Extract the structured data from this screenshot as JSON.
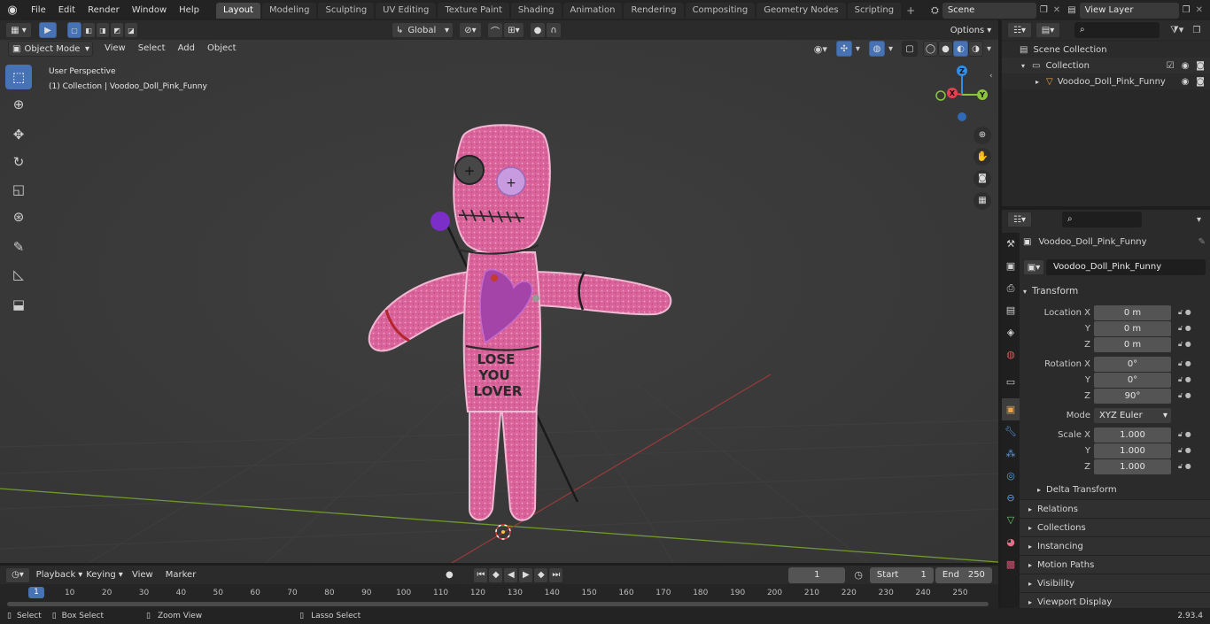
{
  "topbar": {
    "menus": [
      "File",
      "Edit",
      "Render",
      "Window",
      "Help"
    ],
    "workspaces": [
      "Layout",
      "Modeling",
      "Sculpting",
      "UV Editing",
      "Texture Paint",
      "Shading",
      "Animation",
      "Rendering",
      "Compositing",
      "Geometry Nodes",
      "Scripting"
    ],
    "active_workspace": "Layout",
    "scene_name": "Scene",
    "view_layer": "View Layer"
  },
  "header": {
    "transform_orientation": "Global",
    "options_label": "Options"
  },
  "viewport": {
    "mode": "Object Mode",
    "menus": [
      "View",
      "Select",
      "Add",
      "Object"
    ],
    "overlay_title": "User Perspective",
    "overlay_subtitle": "(1) Collection | Voodoo_Doll_Pink_Funny",
    "gizmo_axes": {
      "x": "X",
      "y": "Y",
      "z": "Z"
    },
    "doll_text": [
      "LOSE",
      "YOU",
      "LOVER"
    ]
  },
  "outliner": {
    "scene_collection": "Scene Collection",
    "collection": "Collection",
    "object": "Voodoo_Doll_Pink_Funny"
  },
  "properties": {
    "object_name": "Voodoo_Doll_Pink_Funny",
    "datablock_name": "Voodoo_Doll_Pink_Funny",
    "transform_label": "Transform",
    "location_label": "Location X",
    "rotation_label": "Rotation X",
    "scale_label": "Scale X",
    "y_label": "Y",
    "z_label": "Z",
    "location": [
      "0 m",
      "0 m",
      "0 m"
    ],
    "rotation": [
      "0°",
      "0°",
      "90°"
    ],
    "mode_label": "Mode",
    "mode_value": "XYZ Euler",
    "scale": [
      "1.000",
      "1.000",
      "1.000"
    ],
    "delta_transform": "Delta Transform",
    "sections": [
      "Relations",
      "Collections",
      "Instancing",
      "Motion Paths",
      "Visibility",
      "Viewport Display"
    ]
  },
  "timeline": {
    "menus": [
      "Playback",
      "Keying",
      "View",
      "Marker"
    ],
    "current_frame": "1",
    "start_label": "Start",
    "start_value": "1",
    "end_label": "End",
    "end_value": "250",
    "ticks": [
      "1",
      "10",
      "20",
      "30",
      "40",
      "50",
      "60",
      "70",
      "80",
      "90",
      "100",
      "110",
      "120",
      "130",
      "140",
      "150",
      "160",
      "170",
      "180",
      "190",
      "200",
      "210",
      "220",
      "230",
      "240",
      "250"
    ]
  },
  "statusbar": {
    "select": "Select",
    "box_select": "Box Select",
    "zoom_view": "Zoom View",
    "lasso_select": "Lasso Select",
    "version": "2.93.4"
  },
  "colors": {
    "accent": "#4772b3",
    "doll_pink": "#d9639a",
    "x_axis": "#e5404f",
    "y_axis": "#8ac53b",
    "z_axis": "#2f8ee6"
  }
}
